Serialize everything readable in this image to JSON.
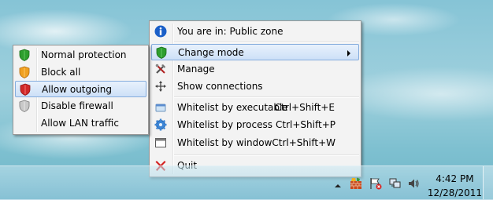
{
  "main_menu": {
    "zone_label": "You are in: Public zone",
    "change_mode_label": "Change mode",
    "manage_label": "Manage",
    "show_connections_label": "Show connections",
    "whitelist_executable_label": "Whitelist by executable",
    "whitelist_executable_shortcut": "Ctrl+Shift+E",
    "whitelist_process_label": "Whitelist by process",
    "whitelist_process_shortcut": "Ctrl+Shift+P",
    "whitelist_window_label": "Whitelist by window",
    "whitelist_window_shortcut": "Ctrl+Shift+W",
    "quit_label": "Quit"
  },
  "mode_submenu": {
    "items": [
      {
        "label": "Normal protection",
        "icon": "green-shield-icon"
      },
      {
        "label": "Block all",
        "icon": "orange-shield-icon"
      },
      {
        "label": "Allow outgoing",
        "icon": "red-shield-icon",
        "highlighted": true
      },
      {
        "label": "Disable firewall",
        "icon": "gray-shield-icon"
      },
      {
        "label": "Allow LAN traffic",
        "icon": ""
      }
    ]
  },
  "taskbar": {
    "clock_time": "4:42 PM",
    "clock_date": "12/28/2011"
  },
  "colors": {
    "highlight_border": "#84acdd",
    "menu_bg": "#f3f3f3"
  }
}
